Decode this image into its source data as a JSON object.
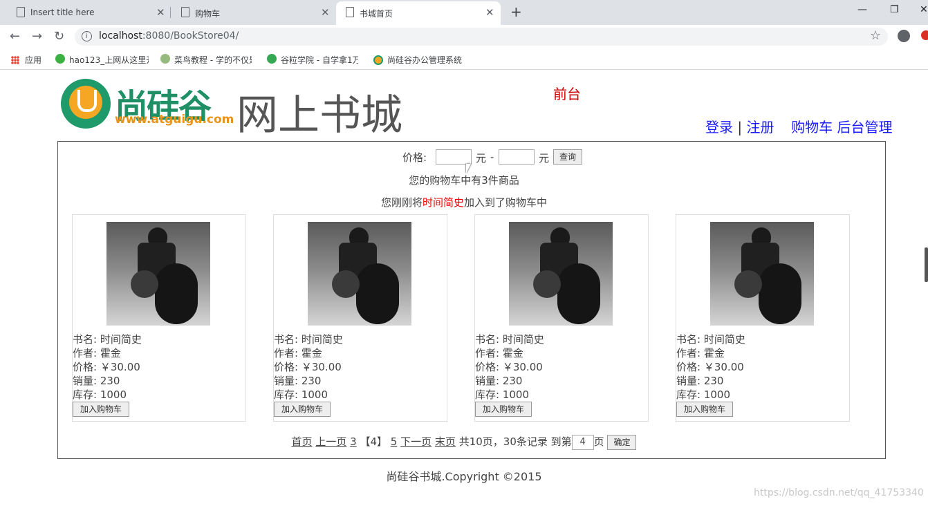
{
  "browser": {
    "tabs": [
      {
        "title": "Insert title here",
        "active": false
      },
      {
        "title": "购物车",
        "active": false
      },
      {
        "title": "书城首页",
        "active": true
      }
    ],
    "new_tab_icon": "plus-icon",
    "url_host": "localhost",
    "url_rest": ":8080/BookStore04/",
    "bookmarks": [
      {
        "label": "应用",
        "icon": "apps-grid-icon"
      },
      {
        "label": "hao123_上网从这里开始",
        "icon": "hao123-icon"
      },
      {
        "label": "菜鸟教程 - 学的不仅是技术",
        "icon": "runoob-icon"
      },
      {
        "label": "谷粒学院 - 自学拿1万",
        "icon": "guli-icon"
      },
      {
        "label": "尚硅谷办公管理系统",
        "icon": "atguigu-icon"
      }
    ]
  },
  "header": {
    "logo_cn": "尚硅谷",
    "logo_url": "www.atguigu.com",
    "site_title": "网上书城",
    "front_label": "前台",
    "nav": {
      "login": "登录",
      "separator": "|",
      "register": "注册",
      "cart": "购物车",
      "admin": "后台管理"
    }
  },
  "search": {
    "price_label": "价格:",
    "unit": "元",
    "dash": "-",
    "query_button": "查询"
  },
  "cart_info": {
    "summary": "您的购物车中有3件商品",
    "added_prefix": "您刚刚将",
    "added_book": "时间简史",
    "added_suffix": "加入到了购物车中"
  },
  "books": [
    {
      "name_label": "书名:",
      "name": "时间简史",
      "author_label": "作者:",
      "author": "霍金",
      "price_label": "价格:",
      "price": "￥30.00",
      "sales_label": "销量:",
      "sales": "230",
      "stock_label": "库存:",
      "stock": "1000",
      "button": "加入购物车"
    },
    {
      "name_label": "书名:",
      "name": "时间简史",
      "author_label": "作者:",
      "author": "霍金",
      "price_label": "价格:",
      "price": "￥30.00",
      "sales_label": "销量:",
      "sales": "230",
      "stock_label": "库存:",
      "stock": "1000",
      "button": "加入购物车"
    },
    {
      "name_label": "书名:",
      "name": "时间简史",
      "author_label": "作者:",
      "author": "霍金",
      "price_label": "价格:",
      "price": "￥30.00",
      "sales_label": "销量:",
      "sales": "230",
      "stock_label": "库存:",
      "stock": "1000",
      "button": "加入购物车"
    },
    {
      "name_label": "书名:",
      "name": "时间简史",
      "author_label": "作者:",
      "author": "霍金",
      "price_label": "价格:",
      "price": "￥30.00",
      "sales_label": "销量:",
      "sales": "230",
      "stock_label": "库存:",
      "stock": "1000",
      "button": "加入购物车"
    }
  ],
  "pager": {
    "first": "首页",
    "prev": "上一页",
    "prev_num": "3",
    "current": "【4】",
    "next_num": "5",
    "next": "下一页",
    "last": "末页",
    "summary": "共10页，30条记录",
    "goto_prefix": "到第",
    "goto_value": "4",
    "goto_suffix": "页",
    "confirm": "确定"
  },
  "footer": "尚硅谷书城.Copyright ©2015",
  "watermark": "https://blog.csdn.net/qq_41753340",
  "colors": {
    "link": "#1a1aff",
    "highlight": "#e00000",
    "front_label": "#cc0000"
  }
}
